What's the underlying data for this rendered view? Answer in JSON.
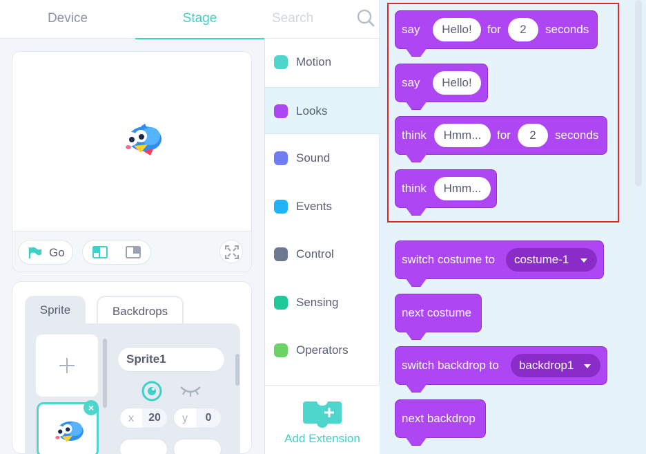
{
  "tabs": [
    {
      "label": "Device",
      "active": false
    },
    {
      "label": "Stage",
      "active": true
    }
  ],
  "stage_controls": {
    "go_label": "Go"
  },
  "sprite_panel": {
    "tabs": [
      {
        "label": "Sprite",
        "active": true
      },
      {
        "label": "Backdrops",
        "active": false
      }
    ],
    "sprite_name": "Sprite1",
    "x_label": "x",
    "x_value": "20",
    "y_label": "y",
    "y_value": "0"
  },
  "search": {
    "placeholder": "Search"
  },
  "categories": [
    {
      "label": "Motion",
      "color": "#4fd6cc",
      "active": false
    },
    {
      "label": "Looks",
      "color": "#ae47f3",
      "active": true
    },
    {
      "label": "Sound",
      "color": "#6f7cf4",
      "active": false
    },
    {
      "label": "Events",
      "color": "#1eb4f5",
      "active": false
    },
    {
      "label": "Control",
      "color": "#6f7891",
      "active": false
    },
    {
      "label": "Sensing",
      "color": "#1ec898",
      "active": false
    },
    {
      "label": "Operators",
      "color": "#6bd266",
      "active": false
    }
  ],
  "extension": {
    "label": "Add Extension"
  },
  "blocks": [
    {
      "parts": [
        "say",
        "Hello!",
        "for",
        "2",
        "seconds"
      ]
    },
    {
      "parts": [
        "say",
        "Hello!"
      ]
    },
    {
      "parts": [
        "think",
        "Hmm...",
        "for",
        "2",
        "seconds"
      ]
    },
    {
      "parts": [
        "think",
        "Hmm..."
      ]
    },
    {
      "parts": [
        "switch costume to",
        "costume-1"
      ]
    },
    {
      "parts": [
        "next costume"
      ]
    },
    {
      "parts": [
        "switch backdrop to",
        "backdrop1"
      ]
    },
    {
      "parts": [
        "next backdrop"
      ]
    }
  ],
  "colors": {
    "accent": "#3ed1c8",
    "looks_block": "#ae47f3",
    "highlight": "#e1262c"
  }
}
